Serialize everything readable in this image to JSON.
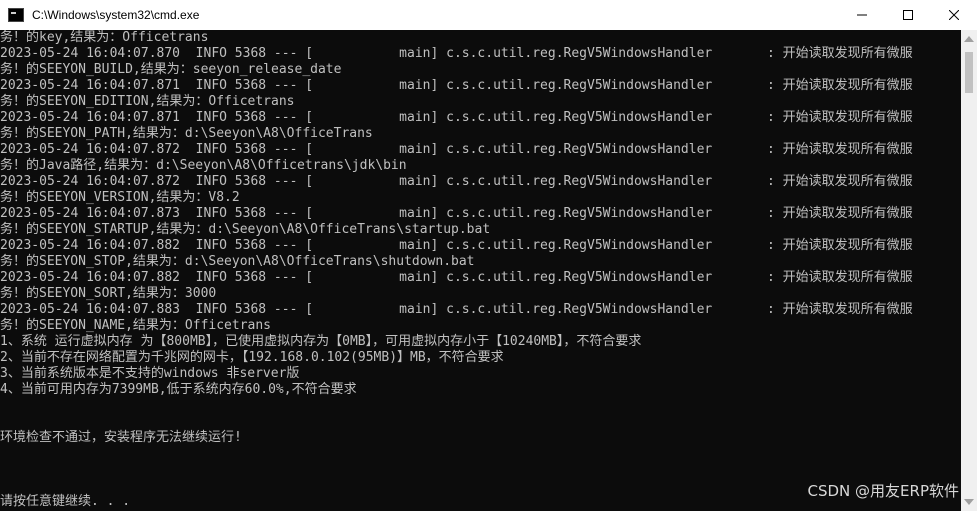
{
  "window": {
    "title": "C:\\Windows\\system32\\cmd.exe",
    "minimize_icon": "minimize-icon",
    "maximize_icon": "maximize-icon",
    "close_icon": "close-icon"
  },
  "console": {
    "lines": [
      "务！的key,结果为：Officetrans",
      "2023-05-24 16:04:07.870  INFO 5368 --- [           main] c.s.c.util.reg.RegV5WindowsHandler       : 开始读取发现所有微服",
      "务！的SEEYON_BUILD,结果为：seeyon_release_date",
      "2023-05-24 16:04:07.871  INFO 5368 --- [           main] c.s.c.util.reg.RegV5WindowsHandler       : 开始读取发现所有微服",
      "务！的SEEYON_EDITION,结果为：Officetrans",
      "2023-05-24 16:04:07.871  INFO 5368 --- [           main] c.s.c.util.reg.RegV5WindowsHandler       : 开始读取发现所有微服",
      "务！的SEEYON_PATH,结果为：d:\\Seeyon\\A8\\OfficeTrans",
      "2023-05-24 16:04:07.872  INFO 5368 --- [           main] c.s.c.util.reg.RegV5WindowsHandler       : 开始读取发现所有微服",
      "务！的Java路径,结果为：d:\\Seeyon\\A8\\Officetrans\\jdk\\bin",
      "2023-05-24 16:04:07.872  INFO 5368 --- [           main] c.s.c.util.reg.RegV5WindowsHandler       : 开始读取发现所有微服",
      "务！的SEEYON_VERSION,结果为：V8.2",
      "2023-05-24 16:04:07.873  INFO 5368 --- [           main] c.s.c.util.reg.RegV5WindowsHandler       : 开始读取发现所有微服",
      "务！的SEEYON_STARTUP,结果为：d:\\Seeyon\\A8\\OfficeTrans\\startup.bat",
      "2023-05-24 16:04:07.882  INFO 5368 --- [           main] c.s.c.util.reg.RegV5WindowsHandler       : 开始读取发现所有微服",
      "务！的SEEYON_STOP,结果为：d:\\Seeyon\\A8\\OfficeTrans\\shutdown.bat",
      "2023-05-24 16:04:07.882  INFO 5368 --- [           main] c.s.c.util.reg.RegV5WindowsHandler       : 开始读取发现所有微服",
      "务！的SEEYON_SORT,结果为：3000",
      "2023-05-24 16:04:07.883  INFO 5368 --- [           main] c.s.c.util.reg.RegV5WindowsHandler       : 开始读取发现所有微服",
      "务！的SEEYON_NAME,结果为：Officetrans",
      "1、系统 运行虚拟内存 为【800MB】，已使用虚拟内存为【0MB】，可用虚拟内存小于【10240MB】，不符合要求",
      "2、当前不存在网络配置为千兆网的网卡，【192.168.0.102(95MB)】MB，不符合要求",
      "3、当前系统版本是不支持的windows 非server版",
      "4、当前可用内存为7399MB,低于系统内存60.0%,不符合要求",
      "",
      "",
      "环境检查不通过，安装程序无法继续运行!",
      "",
      "",
      "",
      "请按任意键继续. . ."
    ]
  },
  "watermark": "CSDN @用友ERP软件"
}
